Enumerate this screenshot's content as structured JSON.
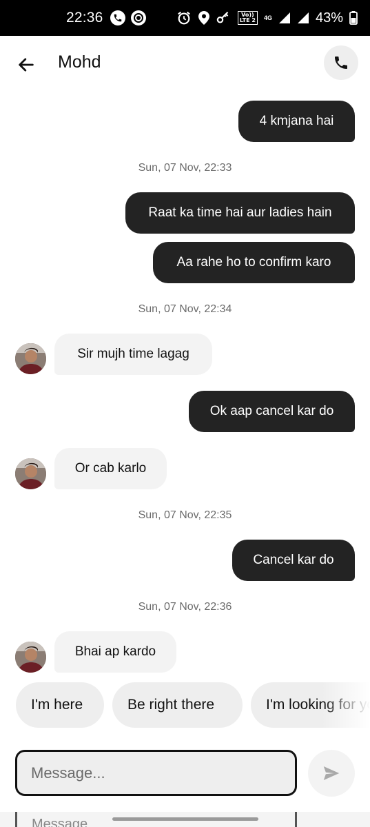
{
  "status_bar": {
    "time": "22:36",
    "battery": "43%",
    "volte_line1": "Vo))",
    "volte_line2": "LTE 2",
    "network": "4G"
  },
  "header": {
    "contact_name": "Mohd"
  },
  "messages": [
    {
      "type": "out",
      "text": "4 kmjana hai"
    },
    {
      "type": "timestamp",
      "text": "Sun, 07 Nov, 22:33"
    },
    {
      "type": "out",
      "text": "Raat ka time hai aur ladies hain"
    },
    {
      "type": "out",
      "text": "Aa rahe ho to confirm karo"
    },
    {
      "type": "timestamp",
      "text": "Sun, 07 Nov, 22:34"
    },
    {
      "type": "in",
      "text": "Sir mujh time lagag"
    },
    {
      "type": "out",
      "text": "Ok aap cancel kar do"
    },
    {
      "type": "in",
      "text": "Or cab karlo"
    },
    {
      "type": "timestamp",
      "text": "Sun, 07 Nov, 22:35"
    },
    {
      "type": "out",
      "text": "Cancel kar do"
    },
    {
      "type": "timestamp",
      "text": "Sun, 07 Nov, 22:36"
    },
    {
      "type": "in",
      "text": "Bhai ap kardo"
    }
  ],
  "quick_replies": [
    "I'm here",
    "Be right there",
    "I'm looking for you"
  ],
  "composer": {
    "placeholder": "Message...",
    "value": ""
  },
  "ghost_composer": {
    "placeholder": "Message"
  },
  "colors": {
    "outgoing_bubble": "#232323",
    "incoming_bubble": "#f3f3f3",
    "chip_bg": "#eeeeee"
  }
}
